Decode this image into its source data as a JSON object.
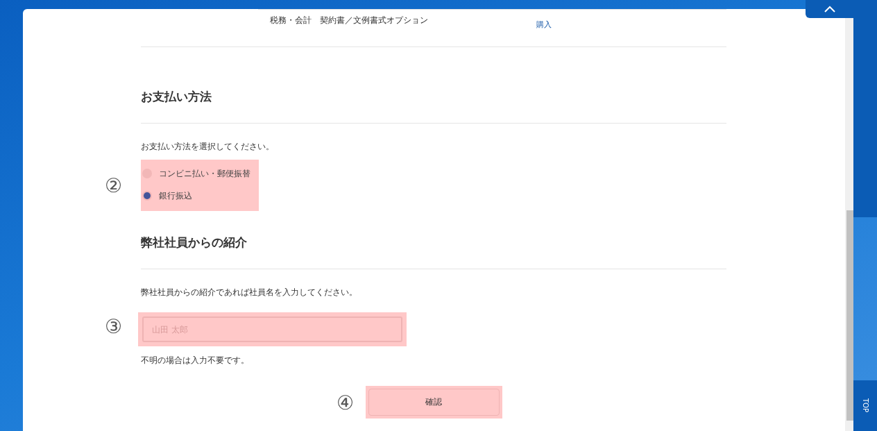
{
  "purchase_row": {
    "name": "税務・会計　契約書／文例書式オプション",
    "action": "購入"
  },
  "payment": {
    "heading": "お支払い方法",
    "instruction": "お支払い方法を選択してください。",
    "annotation": "②",
    "options": [
      {
        "label": "コンビニ払い・郵便振替",
        "selected": false
      },
      {
        "label": "銀行振込",
        "selected": true
      }
    ]
  },
  "referral": {
    "heading": "弊社社員からの紹介",
    "instruction": "弊社社員からの紹介であれば社員名を入力してください。",
    "annotation": "③",
    "placeholder": "山田 太郎",
    "note": "不明の場合は入力不要です。"
  },
  "confirm": {
    "annotation": "④",
    "label": "確認"
  },
  "top_button": {
    "label": "TOP"
  }
}
